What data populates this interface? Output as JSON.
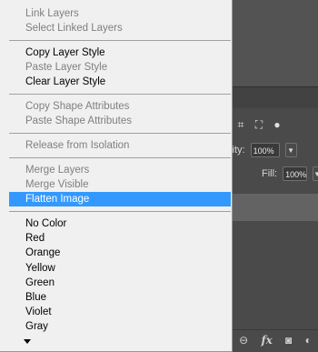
{
  "menu": {
    "items": [
      {
        "label": "Link Layers",
        "enabled": false
      },
      {
        "label": "Select Linked Layers",
        "enabled": false
      },
      {
        "label": "Copy Layer Style",
        "enabled": true
      },
      {
        "label": "Paste Layer Style",
        "enabled": false
      },
      {
        "label": "Clear Layer Style",
        "enabled": true
      },
      {
        "label": "Copy Shape Attributes",
        "enabled": false
      },
      {
        "label": "Paste Shape Attributes",
        "enabled": false
      },
      {
        "label": "Release from Isolation",
        "enabled": false
      },
      {
        "label": "Merge Layers",
        "enabled": false
      },
      {
        "label": "Merge Visible",
        "enabled": false
      },
      {
        "label": "Flatten Image",
        "enabled": true,
        "highlighted": true
      },
      {
        "label": "No Color",
        "enabled": true
      },
      {
        "label": "Red",
        "enabled": true
      },
      {
        "label": "Orange",
        "enabled": true
      },
      {
        "label": "Yellow",
        "enabled": true
      },
      {
        "label": "Green",
        "enabled": true
      },
      {
        "label": "Blue",
        "enabled": true
      },
      {
        "label": "Violet",
        "enabled": true
      },
      {
        "label": "Gray",
        "enabled": true
      }
    ],
    "more_icon": "chevron-down-icon",
    "highlight_color": "#3399ff"
  },
  "layers_panel": {
    "opacity_label": "city:",
    "opacity_value": "100%",
    "fill_label": "Fill:",
    "fill_value": "100%",
    "bottom_icons": [
      "link-icon",
      "fx-icon",
      "mask-icon",
      "adjustment-icon"
    ],
    "fx_label": "fx"
  }
}
